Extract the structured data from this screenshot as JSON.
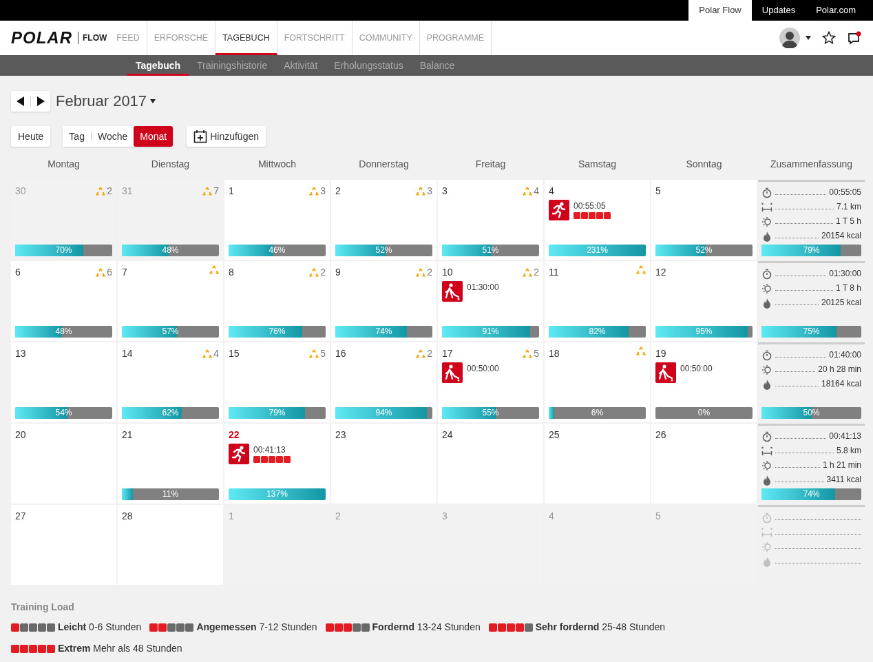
{
  "top_links": [
    {
      "label": "Polar Flow",
      "selected": true
    },
    {
      "label": "Updates",
      "selected": false
    },
    {
      "label": "Polar.com",
      "selected": false
    }
  ],
  "brand": {
    "logo": "POLAR",
    "product": "FLOW"
  },
  "main_nav": [
    {
      "label": "FEED",
      "selected": false
    },
    {
      "label": "ERFORSCHE",
      "selected": false
    },
    {
      "label": "TAGEBUCH",
      "selected": true
    },
    {
      "label": "FORTSCHRITT",
      "selected": false
    },
    {
      "label": "COMMUNITY",
      "selected": false
    },
    {
      "label": "PROGRAMME",
      "selected": false
    }
  ],
  "sub_nav": [
    {
      "label": "Tagebuch",
      "selected": true
    },
    {
      "label": "Trainingshistorie",
      "selected": false
    },
    {
      "label": "Aktivität",
      "selected": false
    },
    {
      "label": "Erholungsstatus",
      "selected": false
    },
    {
      "label": "Balance",
      "selected": false
    }
  ],
  "period": {
    "title": "Februar 2017"
  },
  "today_button": "Heute",
  "views": [
    {
      "label": "Tag",
      "selected": false
    },
    {
      "label": "Woche",
      "selected": false
    },
    {
      "label": "Monat",
      "selected": true
    }
  ],
  "add_button": "Hinzufügen",
  "weekday_headers": [
    "Montag",
    "Dienstag",
    "Mittwoch",
    "Donnerstag",
    "Freitag",
    "Samstag",
    "Sonntag",
    "Zusammenfassung"
  ],
  "weeks": [
    {
      "days": [
        {
          "date": "30",
          "muted": true,
          "today": false,
          "alert": true,
          "alert_count": "2",
          "bar": {
            "level": 0.7,
            "reading": "70%"
          }
        },
        {
          "date": "31",
          "muted": true,
          "today": false,
          "alert": true,
          "alert_count": "7",
          "bar": {
            "level": 0.48,
            "reading": "48%"
          }
        },
        {
          "date": "1",
          "muted": false,
          "today": false,
          "alert": true,
          "alert_count": "3",
          "bar": {
            "level": 0.46,
            "reading": "46%"
          }
        },
        {
          "date": "2",
          "muted": false,
          "today": false,
          "alert": true,
          "alert_count": "3",
          "bar": {
            "level": 0.52,
            "reading": "52%"
          }
        },
        {
          "date": "3",
          "muted": false,
          "today": false,
          "alert": true,
          "alert_count": "4",
          "bar": {
            "level": 0.51,
            "reading": "51%"
          }
        },
        {
          "date": "4",
          "muted": false,
          "today": false,
          "alert": false,
          "training": {
            "kind": "running",
            "time": "00:55:05",
            "stars": 5
          },
          "bar": {
            "level": 1,
            "reading": "231%"
          }
        },
        {
          "date": "5",
          "muted": false,
          "today": false,
          "alert": false,
          "bar": {
            "level": 0.52,
            "reading": "52%"
          }
        }
      ],
      "summary": {
        "stats": [
          {
            "kind": "duration",
            "value": "00:55:05"
          },
          {
            "kind": "distance",
            "value": "7.1 km"
          },
          {
            "kind": "activity",
            "value": "1 T 5 h"
          },
          {
            "kind": "calories",
            "value": "20154 kcal"
          }
        ],
        "bar": {
          "level": 0.79,
          "reading": "79%"
        }
      }
    },
    {
      "days": [
        {
          "date": "6",
          "muted": false,
          "today": false,
          "alert": true,
          "alert_count": "6",
          "bar": {
            "level": 0.48,
            "reading": "48%"
          }
        },
        {
          "date": "7",
          "muted": false,
          "today": false,
          "alert": true,
          "bar": {
            "level": 0.57,
            "reading": "57%"
          }
        },
        {
          "date": "8",
          "muted": false,
          "today": false,
          "alert": true,
          "alert_count": "2",
          "bar": {
            "level": 0.76,
            "reading": "76%"
          }
        },
        {
          "date": "9",
          "muted": false,
          "today": false,
          "alert": true,
          "alert_count": "2",
          "bar": {
            "level": 0.74,
            "reading": "74%"
          }
        },
        {
          "date": "10",
          "muted": false,
          "today": false,
          "alert": true,
          "alert_count": "2",
          "training": {
            "kind": "hockey",
            "time": "01:30:00"
          },
          "bar": {
            "level": 0.91,
            "reading": "91%"
          }
        },
        {
          "date": "11",
          "muted": false,
          "today": false,
          "alert": true,
          "bar": {
            "level": 0.82,
            "reading": "82%"
          }
        },
        {
          "date": "12",
          "muted": false,
          "today": false,
          "alert": false,
          "bar": {
            "level": 0.95,
            "reading": "95%"
          }
        }
      ],
      "summary": {
        "stats": [
          {
            "kind": "duration",
            "value": "01:30:00"
          },
          {
            "kind": "activity",
            "value": "1 T 8 h"
          },
          {
            "kind": "calories",
            "value": "20125 kcal"
          }
        ],
        "bar": {
          "level": 0.75,
          "reading": "75%"
        }
      }
    },
    {
      "days": [
        {
          "date": "13",
          "muted": false,
          "today": false,
          "alert": false,
          "bar": {
            "level": 0.54,
            "reading": "54%"
          }
        },
        {
          "date": "14",
          "muted": false,
          "today": false,
          "alert": true,
          "alert_count": "4",
          "bar": {
            "level": 0.62,
            "reading": "62%"
          }
        },
        {
          "date": "15",
          "muted": false,
          "today": false,
          "alert": true,
          "alert_count": "5",
          "bar": {
            "level": 0.79,
            "reading": "79%"
          }
        },
        {
          "date": "16",
          "muted": false,
          "today": false,
          "alert": true,
          "alert_count": "2",
          "bar": {
            "level": 0.94,
            "reading": "94%"
          }
        },
        {
          "date": "17",
          "muted": false,
          "today": false,
          "alert": true,
          "alert_count": "5",
          "training": {
            "kind": "hockey",
            "time": "00:50:00"
          },
          "bar": {
            "level": 0.55,
            "reading": "55%"
          }
        },
        {
          "date": "18",
          "muted": false,
          "today": false,
          "alert": true,
          "bar": {
            "level": 0.06,
            "reading": "6%"
          }
        },
        {
          "date": "19",
          "muted": false,
          "today": false,
          "alert": false,
          "training": {
            "kind": "hockey",
            "time": "00:50:00"
          },
          "bar": {
            "level": 0,
            "reading": "0%"
          }
        }
      ],
      "summary": {
        "stats": [
          {
            "kind": "duration",
            "value": "01:40:00"
          },
          {
            "kind": "activity",
            "value": "20 h 28 min"
          },
          {
            "kind": "calories",
            "value": "18164 kcal"
          }
        ],
        "bar": {
          "level": 0.5,
          "reading": "50%"
        }
      }
    },
    {
      "days": [
        {
          "date": "20",
          "muted": false,
          "today": false,
          "alert": false
        },
        {
          "date": "21",
          "muted": false,
          "today": false,
          "alert": false,
          "bar": {
            "level": 0.11,
            "reading": "11%"
          }
        },
        {
          "date": "22",
          "muted": false,
          "today": true,
          "alert": false,
          "training": {
            "kind": "running",
            "time": "00:41:13",
            "stars": 5
          },
          "bar": {
            "level": 1,
            "reading": "137%"
          }
        },
        {
          "date": "23",
          "muted": false,
          "today": false,
          "alert": false
        },
        {
          "date": "24",
          "muted": false,
          "today": false,
          "alert": false
        },
        {
          "date": "25",
          "muted": false,
          "today": false,
          "alert": false
        },
        {
          "date": "26",
          "muted": false,
          "today": false,
          "alert": false
        }
      ],
      "summary": {
        "stats": [
          {
            "kind": "duration",
            "value": "00:41:13"
          },
          {
            "kind": "distance",
            "value": "5.8 km"
          },
          {
            "kind": "activity",
            "value": "1 h 21 min"
          },
          {
            "kind": "calories",
            "value": "3411 kcal"
          }
        ],
        "bar": {
          "level": 0.74,
          "reading": "74%"
        }
      }
    },
    {
      "days": [
        {
          "date": "27",
          "muted": false,
          "today": false,
          "alert": false
        },
        {
          "date": "28",
          "muted": false,
          "today": false,
          "alert": false
        },
        {
          "date": "1",
          "muted": true,
          "today": false,
          "alert": false
        },
        {
          "date": "2",
          "muted": true,
          "today": false,
          "alert": false
        },
        {
          "date": "3",
          "muted": true,
          "today": false,
          "alert": false
        },
        {
          "date": "4",
          "muted": true,
          "today": false,
          "alert": false
        },
        {
          "date": "5",
          "muted": true,
          "today": false,
          "alert": false
        }
      ],
      "summary": {
        "stats": [
          {
            "kind": "duration"
          },
          {
            "kind": "distance"
          },
          {
            "kind": "activity"
          },
          {
            "kind": "calories"
          }
        ]
      }
    }
  ],
  "legend": {
    "title": "Training Load",
    "items": [
      {
        "stars": 1,
        "name": "Leicht",
        "range": "0-6 Stunden"
      },
      {
        "stars": 2,
        "name": "Angemessen",
        "range": "7-12 Stunden"
      },
      {
        "stars": 3,
        "name": "Fordernd",
        "range": "13-24 Stunden"
      },
      {
        "stars": 4,
        "name": "Sehr fordernd",
        "range": "25-48 Stunden"
      },
      {
        "stars": 5,
        "name": "Extrem",
        "range": "Mehr als 48 Stunden"
      }
    ]
  }
}
